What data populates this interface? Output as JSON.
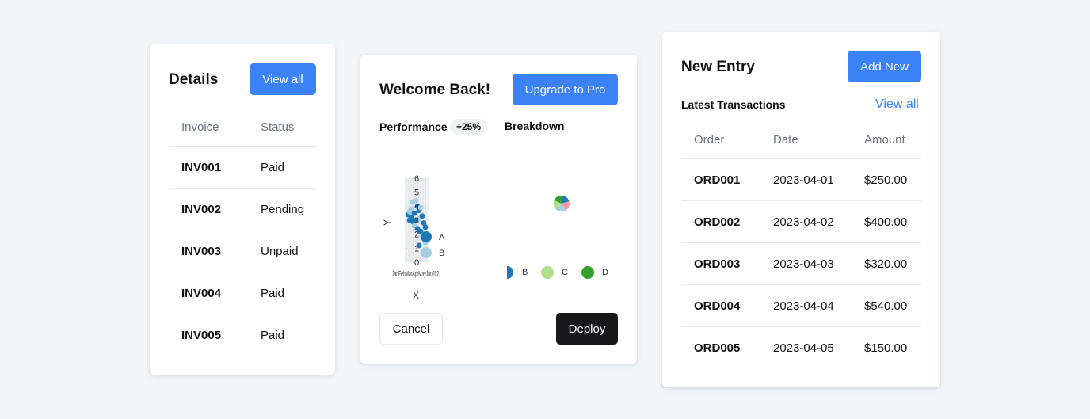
{
  "details_card": {
    "title": "Details",
    "view_all_label": "View all",
    "columns": [
      "Invoice",
      "Status"
    ],
    "rows": [
      {
        "invoice": "INV001",
        "status": "Paid"
      },
      {
        "invoice": "INV002",
        "status": "Pending"
      },
      {
        "invoice": "INV003",
        "status": "Unpaid"
      },
      {
        "invoice": "INV004",
        "status": "Paid"
      },
      {
        "invoice": "INV005",
        "status": "Paid"
      }
    ]
  },
  "welcome_card": {
    "title": "Welcome Back!",
    "upgrade_label": "Upgrade to Pro",
    "performance_label": "Performance",
    "performance_badge": "+25%",
    "breakdown_label": "Breakdown",
    "cancel_label": "Cancel",
    "deploy_label": "Deploy",
    "colors": {
      "series_a": "#1f78b4",
      "series_b": "#a6cee3",
      "series_c": "#b2df8a",
      "series_d": "#33a02c",
      "pie_e": "#fb9a99"
    }
  },
  "chart_data": [
    {
      "type": "scatter",
      "xlabel": "X",
      "ylabel": "Y",
      "yticks": [
        "0",
        "1",
        "2",
        "3",
        "4",
        "5",
        "6"
      ],
      "xtick_label_overlap": "JanFebMarAprMayJun2021",
      "ylim": [
        0,
        6
      ],
      "legend": [
        "A",
        "B"
      ],
      "legend_position": "right"
    },
    {
      "type": "pie",
      "legend": [
        "B",
        "C",
        "D"
      ],
      "legend_position": "bottom"
    }
  ],
  "entry_card": {
    "title": "New Entry",
    "add_new_label": "Add New",
    "subtitle": "Latest Transactions",
    "view_all_label": "View all",
    "columns": [
      "Order",
      "Date",
      "Amount"
    ],
    "rows": [
      {
        "order": "ORD001",
        "date": "2023-04-01",
        "amount": "$250.00"
      },
      {
        "order": "ORD002",
        "date": "2023-04-02",
        "amount": "$400.00"
      },
      {
        "order": "ORD003",
        "date": "2023-04-03",
        "amount": "$320.00"
      },
      {
        "order": "ORD004",
        "date": "2023-04-04",
        "amount": "$540.00"
      },
      {
        "order": "ORD005",
        "date": "2023-04-05",
        "amount": "$150.00"
      }
    ]
  }
}
